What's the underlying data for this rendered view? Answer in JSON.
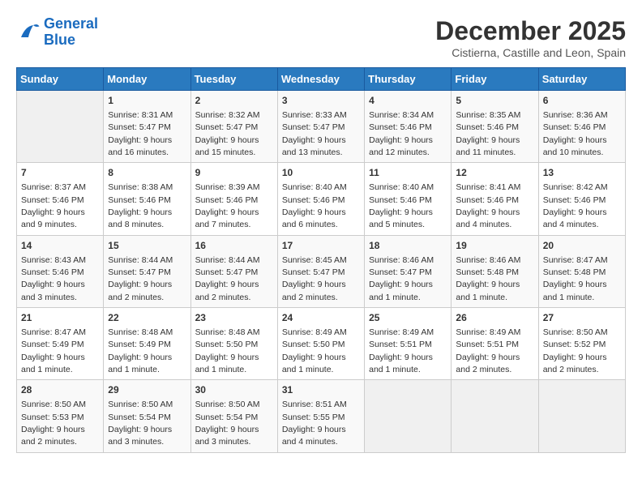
{
  "logo": {
    "line1": "General",
    "line2": "Blue"
  },
  "title": "December 2025",
  "subtitle": "Cistierna, Castille and Leon, Spain",
  "days_header": [
    "Sunday",
    "Monday",
    "Tuesday",
    "Wednesday",
    "Thursday",
    "Friday",
    "Saturday"
  ],
  "weeks": [
    [
      {
        "day": "",
        "info": ""
      },
      {
        "day": "1",
        "info": "Sunrise: 8:31 AM\nSunset: 5:47 PM\nDaylight: 9 hours\nand 16 minutes."
      },
      {
        "day": "2",
        "info": "Sunrise: 8:32 AM\nSunset: 5:47 PM\nDaylight: 9 hours\nand 15 minutes."
      },
      {
        "day": "3",
        "info": "Sunrise: 8:33 AM\nSunset: 5:47 PM\nDaylight: 9 hours\nand 13 minutes."
      },
      {
        "day": "4",
        "info": "Sunrise: 8:34 AM\nSunset: 5:46 PM\nDaylight: 9 hours\nand 12 minutes."
      },
      {
        "day": "5",
        "info": "Sunrise: 8:35 AM\nSunset: 5:46 PM\nDaylight: 9 hours\nand 11 minutes."
      },
      {
        "day": "6",
        "info": "Sunrise: 8:36 AM\nSunset: 5:46 PM\nDaylight: 9 hours\nand 10 minutes."
      }
    ],
    [
      {
        "day": "7",
        "info": "Sunrise: 8:37 AM\nSunset: 5:46 PM\nDaylight: 9 hours\nand 9 minutes."
      },
      {
        "day": "8",
        "info": "Sunrise: 8:38 AM\nSunset: 5:46 PM\nDaylight: 9 hours\nand 8 minutes."
      },
      {
        "day": "9",
        "info": "Sunrise: 8:39 AM\nSunset: 5:46 PM\nDaylight: 9 hours\nand 7 minutes."
      },
      {
        "day": "10",
        "info": "Sunrise: 8:40 AM\nSunset: 5:46 PM\nDaylight: 9 hours\nand 6 minutes."
      },
      {
        "day": "11",
        "info": "Sunrise: 8:40 AM\nSunset: 5:46 PM\nDaylight: 9 hours\nand 5 minutes."
      },
      {
        "day": "12",
        "info": "Sunrise: 8:41 AM\nSunset: 5:46 PM\nDaylight: 9 hours\nand 4 minutes."
      },
      {
        "day": "13",
        "info": "Sunrise: 8:42 AM\nSunset: 5:46 PM\nDaylight: 9 hours\nand 4 minutes."
      }
    ],
    [
      {
        "day": "14",
        "info": "Sunrise: 8:43 AM\nSunset: 5:46 PM\nDaylight: 9 hours\nand 3 minutes."
      },
      {
        "day": "15",
        "info": "Sunrise: 8:44 AM\nSunset: 5:47 PM\nDaylight: 9 hours\nand 2 minutes."
      },
      {
        "day": "16",
        "info": "Sunrise: 8:44 AM\nSunset: 5:47 PM\nDaylight: 9 hours\nand 2 minutes."
      },
      {
        "day": "17",
        "info": "Sunrise: 8:45 AM\nSunset: 5:47 PM\nDaylight: 9 hours\nand 2 minutes."
      },
      {
        "day": "18",
        "info": "Sunrise: 8:46 AM\nSunset: 5:47 PM\nDaylight: 9 hours\nand 1 minute."
      },
      {
        "day": "19",
        "info": "Sunrise: 8:46 AM\nSunset: 5:48 PM\nDaylight: 9 hours\nand 1 minute."
      },
      {
        "day": "20",
        "info": "Sunrise: 8:47 AM\nSunset: 5:48 PM\nDaylight: 9 hours\nand 1 minute."
      }
    ],
    [
      {
        "day": "21",
        "info": "Sunrise: 8:47 AM\nSunset: 5:49 PM\nDaylight: 9 hours\nand 1 minute."
      },
      {
        "day": "22",
        "info": "Sunrise: 8:48 AM\nSunset: 5:49 PM\nDaylight: 9 hours\nand 1 minute."
      },
      {
        "day": "23",
        "info": "Sunrise: 8:48 AM\nSunset: 5:50 PM\nDaylight: 9 hours\nand 1 minute."
      },
      {
        "day": "24",
        "info": "Sunrise: 8:49 AM\nSunset: 5:50 PM\nDaylight: 9 hours\nand 1 minute."
      },
      {
        "day": "25",
        "info": "Sunrise: 8:49 AM\nSunset: 5:51 PM\nDaylight: 9 hours\nand 1 minute."
      },
      {
        "day": "26",
        "info": "Sunrise: 8:49 AM\nSunset: 5:51 PM\nDaylight: 9 hours\nand 2 minutes."
      },
      {
        "day": "27",
        "info": "Sunrise: 8:50 AM\nSunset: 5:52 PM\nDaylight: 9 hours\nand 2 minutes."
      }
    ],
    [
      {
        "day": "28",
        "info": "Sunrise: 8:50 AM\nSunset: 5:53 PM\nDaylight: 9 hours\nand 2 minutes."
      },
      {
        "day": "29",
        "info": "Sunrise: 8:50 AM\nSunset: 5:54 PM\nDaylight: 9 hours\nand 3 minutes."
      },
      {
        "day": "30",
        "info": "Sunrise: 8:50 AM\nSunset: 5:54 PM\nDaylight: 9 hours\nand 3 minutes."
      },
      {
        "day": "31",
        "info": "Sunrise: 8:51 AM\nSunset: 5:55 PM\nDaylight: 9 hours\nand 4 minutes."
      },
      {
        "day": "",
        "info": ""
      },
      {
        "day": "",
        "info": ""
      },
      {
        "day": "",
        "info": ""
      }
    ]
  ]
}
